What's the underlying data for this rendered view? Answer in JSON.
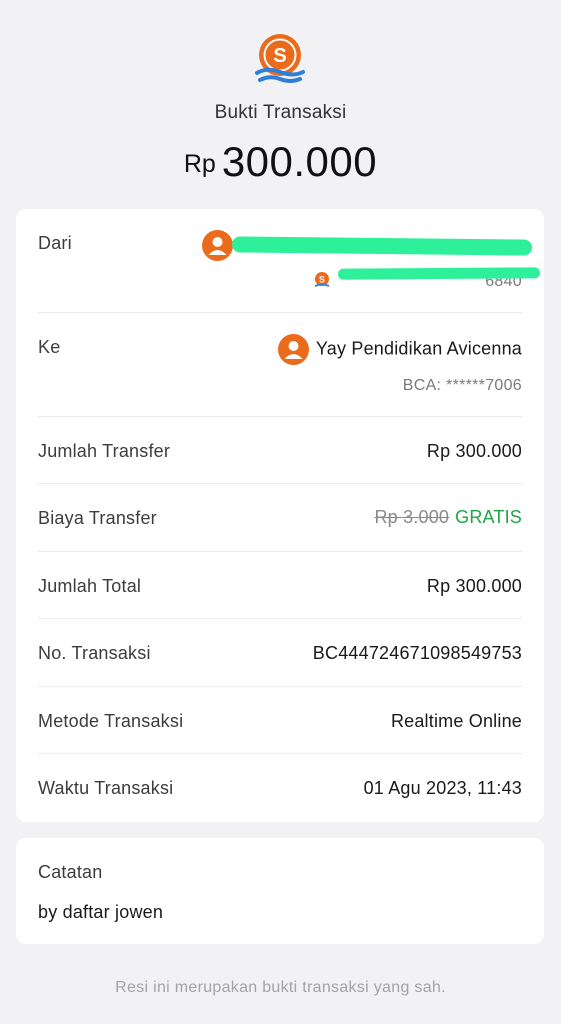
{
  "header": {
    "logo_icon": "seabank-logo-icon",
    "title": "Bukti Transaksi",
    "currency": "Rp",
    "amount": "300.000"
  },
  "details": {
    "from": {
      "label": "Dari",
      "bank_suffix": "6840"
    },
    "to": {
      "label": "Ke",
      "name": "Yay Pendidikan Avicenna",
      "account": "BCA: ******7006"
    },
    "rows": [
      {
        "label": "Jumlah Transfer",
        "value": "Rp 300.000"
      },
      {
        "label": "Biaya Transfer",
        "old_value": "Rp 3.000",
        "value": "GRATIS"
      },
      {
        "label": "Jumlah Total",
        "value": "Rp 300.000"
      },
      {
        "label": "No. Transaksi",
        "value": "BC444724671098549753"
      },
      {
        "label": "Metode Transaksi",
        "value": "Realtime Online"
      },
      {
        "label": "Waktu Transaksi",
        "value": "01 Agu 2023, 11:43"
      }
    ]
  },
  "note": {
    "label": "Catatan",
    "text": "by daftar jowen"
  },
  "footer": {
    "text": "Resi ini merupakan bukti transaksi yang sah."
  },
  "colors": {
    "brand": "#ea6b1b",
    "logo_wave": "#2f7fd8",
    "free": "#22a447",
    "redaction": "#2ff09a"
  }
}
